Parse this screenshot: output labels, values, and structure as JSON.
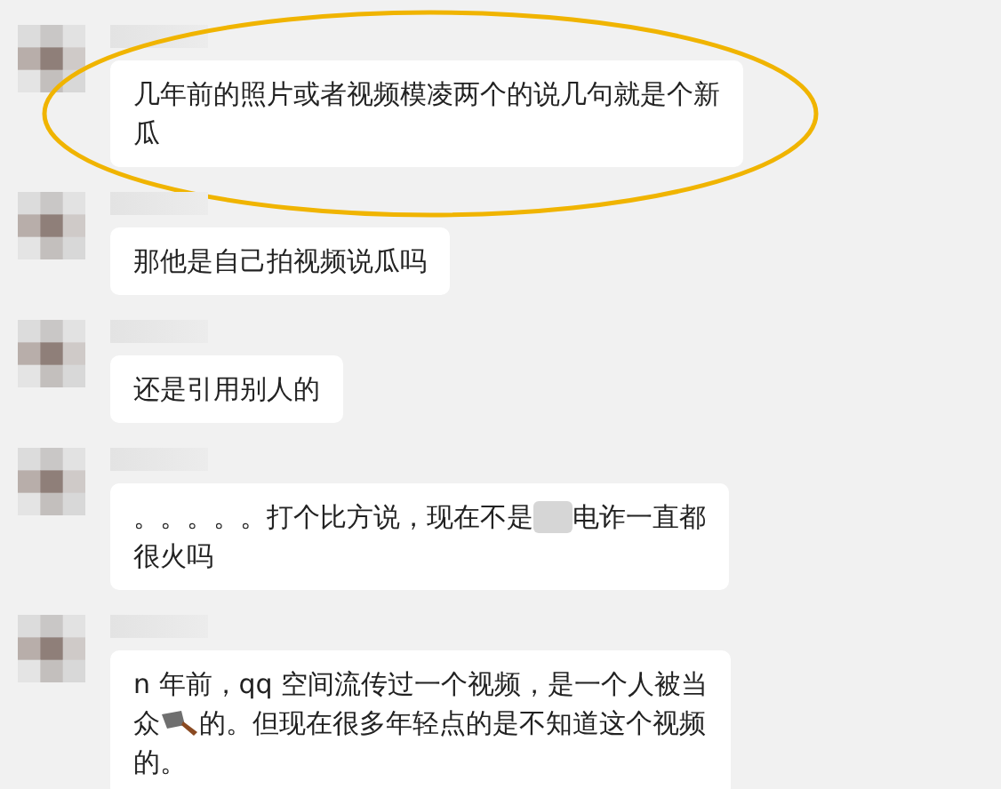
{
  "messages": [
    {
      "highlighted": true,
      "lines": [
        [
          {
            "kind": "text",
            "text": "几年前的照片或者视频模凌两个的说几句就是个新"
          }
        ],
        [
          {
            "kind": "text",
            "text": "瓜"
          }
        ]
      ]
    },
    {
      "highlighted": false,
      "lines": [
        [
          {
            "kind": "text",
            "text": "那他是自己拍视频说瓜吗"
          }
        ]
      ]
    },
    {
      "highlighted": false,
      "lines": [
        [
          {
            "kind": "text",
            "text": "还是引用别人的"
          }
        ]
      ]
    },
    {
      "highlighted": false,
      "lines": [
        [
          {
            "kind": "text",
            "text": "。。。。。打个比方说，现在不是"
          },
          {
            "kind": "redacted"
          },
          {
            "kind": "text",
            "text": "电诈一直都"
          }
        ],
        [
          {
            "kind": "text",
            "text": "很火吗"
          }
        ]
      ]
    },
    {
      "highlighted": false,
      "lines": [
        [
          {
            "kind": "text",
            "text": "n 年前，qq 空间流传过一个视频，是一个人被当"
          }
        ],
        [
          {
            "kind": "text",
            "text": "众"
          },
          {
            "kind": "cleaver"
          },
          {
            "kind": "text",
            "text": "的。但现在很多年轻点的是不知道这个视频"
          }
        ],
        [
          {
            "kind": "text",
            "text": "的。"
          }
        ]
      ]
    }
  ]
}
